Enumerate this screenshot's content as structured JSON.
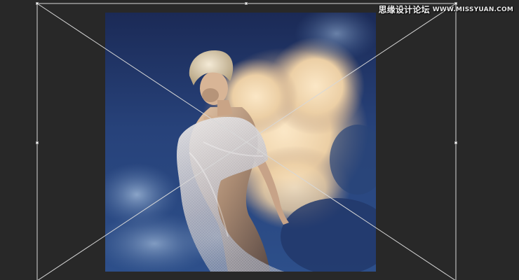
{
  "watermark": {
    "site_name": "思缘设计论坛",
    "site_url": "WWW.MISSYUAN.COM"
  },
  "colors": {
    "workspace_background": "#282828",
    "transform_box": "#d8d8d8",
    "handle": "#ffffff",
    "sky_dark": "#1c2f5e",
    "cloud_light": "#f2dcb8"
  },
  "icons": {
    "transform_handle": "square-handle-icon"
  }
}
